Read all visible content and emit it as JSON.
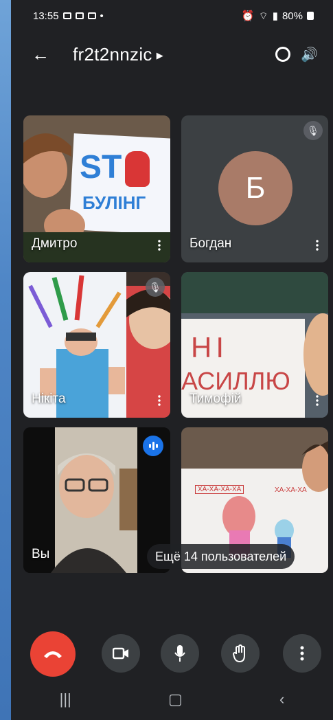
{
  "status_bar": {
    "time": "13:55",
    "battery": "80%"
  },
  "call": {
    "title": "fr2t2nnzic"
  },
  "participants": [
    {
      "name": "Дмитро",
      "muted": false
    },
    {
      "name": "Богдан",
      "avatar_letter": "Б",
      "avatar_color": "#a97b68",
      "muted": true
    },
    {
      "name": "Нікіта",
      "muted": true
    },
    {
      "name": "Тимофій",
      "muted": false
    },
    {
      "name": "Вы",
      "speaking": true
    },
    {
      "name": "",
      "muted": false
    }
  ],
  "tile_texts": {
    "stop_sign_top": "ST",
    "stop_sign_bottom": "БУЛІНГ",
    "poster_line1": "НІ",
    "poster_line2": "АСИЛЛЮ",
    "drawing_label_left": "ХА-ХА-ХА-ХА",
    "drawing_label_right": "ХА-ХА-ХА"
  },
  "more_users_label": "Ещё 14 пользователей",
  "controls": [
    {
      "name": "end-call",
      "icon": "phone-hangup-icon"
    },
    {
      "name": "camera",
      "icon": "video-camera-icon"
    },
    {
      "name": "microphone",
      "icon": "microphone-icon"
    },
    {
      "name": "raise-hand",
      "icon": "hand-icon"
    },
    {
      "name": "more",
      "icon": "more-vertical-icon"
    }
  ],
  "colors": {
    "end_call": "#ea4335",
    "speaking": "#1a73e8",
    "background": "#202124"
  }
}
